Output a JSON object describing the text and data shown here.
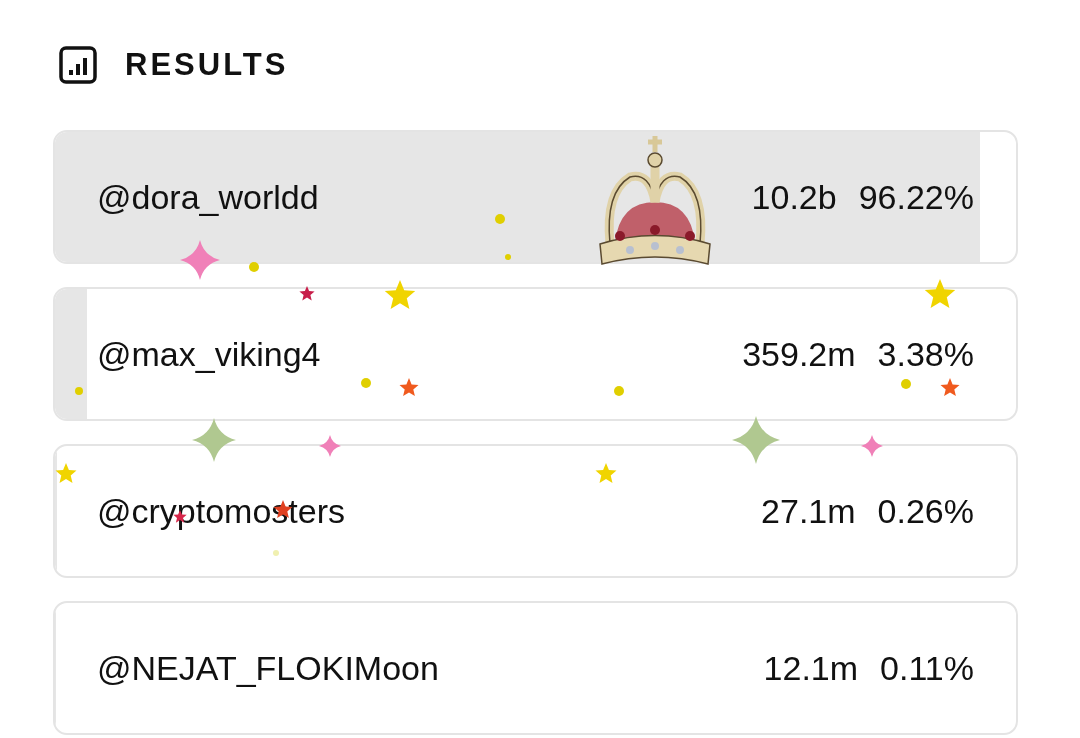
{
  "header": {
    "title": "RESULTS"
  },
  "results": [
    {
      "name": "@dora_worldd",
      "amount": "10.2b",
      "percent": "96.22%",
      "level": 0.9622
    },
    {
      "name": "@max_viking4",
      "amount": "359.2m",
      "percent": "3.38%",
      "level": 0.0338
    },
    {
      "name": "@cryptomosters",
      "amount": "27.1m",
      "percent": "0.26%",
      "level": 0.0026
    },
    {
      "name": "@NEJAT_FLOKIMoon",
      "amount": "12.1m",
      "percent": "0.11%",
      "level": 0.0011
    }
  ]
}
